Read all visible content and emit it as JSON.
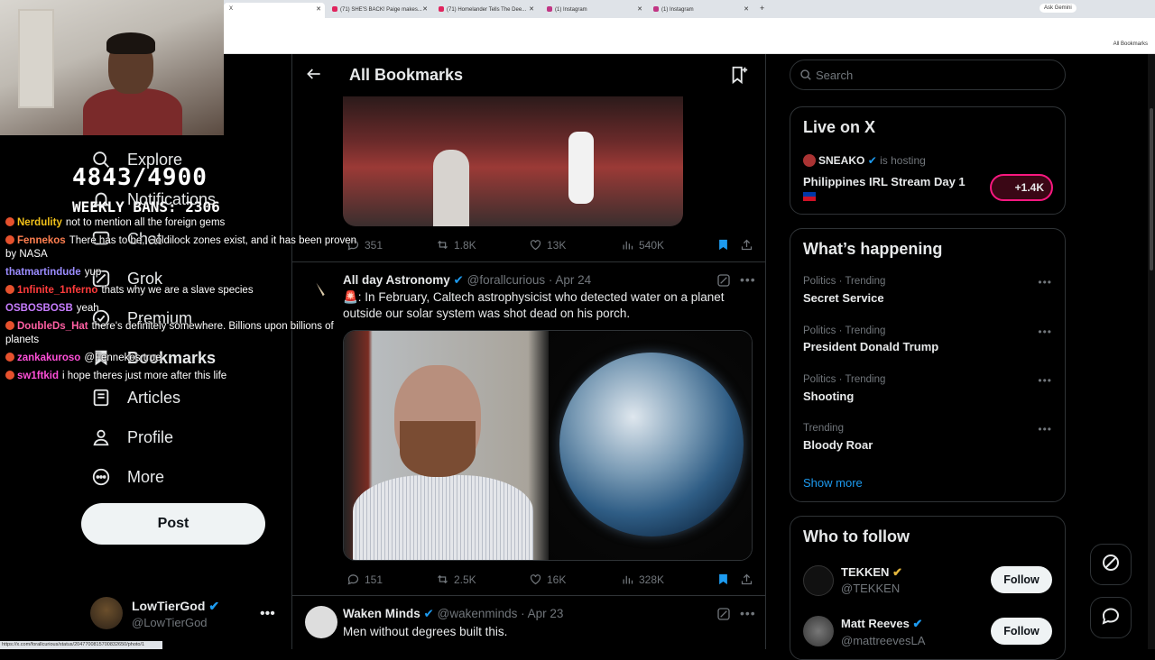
{
  "browser": {
    "tabs": [
      {
        "title": "X",
        "active": true
      },
      {
        "title": "(71) SHE'S BACK! Paige makes...",
        "active": false
      },
      {
        "title": "(71) Homelander Tells The Dee...",
        "active": false
      },
      {
        "title": "(1) Instagram",
        "active": false
      },
      {
        "title": "(1) Instagram",
        "active": false
      }
    ],
    "gemini_label": "Ask Gemini",
    "bookmarks_folder": "All Bookmarks",
    "status_url": "https://x.com/forallcurious/status/2047700815700832650/photo/1"
  },
  "stream": {
    "counter": "4843/4900",
    "weekly": "WEEKLY BANS: 2306",
    "chat": [
      {
        "user": "Nerdulity",
        "color": "#f2c21a",
        "text": "not to mention all the foreign gems"
      },
      {
        "user": "Fennekos",
        "color": "#ff7f50",
        "text": "There has to be, Goldilock zones exist, and it has been proven by NASA"
      },
      {
        "user": "thatmartindude",
        "color": "#9b8cff",
        "text": "yup"
      },
      {
        "user": "1nfinite_1nferno",
        "color": "#ff3b3b",
        "text": "thats why we are a slave species"
      },
      {
        "user": "OSBOSBOSB",
        "color": "#c77dff",
        "text": "yeah"
      },
      {
        "user": "DoubleDs_Hat",
        "color": "#ff5fa2",
        "text": "there's definitely somewhere. Billions upon billions of planets"
      },
      {
        "user": "zankakuroso",
        "color": "#ff4fd8",
        "text": "@Fennekos true"
      },
      {
        "user": "sw1ftkid",
        "color": "#ff4fd8",
        "text": "i hope theres just more after this life"
      }
    ]
  },
  "nav": {
    "items": [
      {
        "label": "Explore",
        "icon": "search-icon"
      },
      {
        "label": "Notifications",
        "icon": "bell-icon"
      },
      {
        "label": "Chat",
        "icon": "chat-icon"
      },
      {
        "label": "Grok",
        "icon": "grok-icon"
      },
      {
        "label": "Premium",
        "icon": "premium-icon"
      },
      {
        "label": "Bookmarks",
        "icon": "bookmark-icon"
      },
      {
        "label": "Articles",
        "icon": "articles-icon"
      },
      {
        "label": "Profile",
        "icon": "profile-icon"
      },
      {
        "label": "More",
        "icon": "more-icon"
      }
    ],
    "post_label": "Post",
    "account": {
      "name": "LowTierGod",
      "handle": "@LowTierGod"
    }
  },
  "main": {
    "title": "All Bookmarks",
    "tweets": [
      {
        "replies": "351",
        "reposts": "1.8K",
        "likes": "13K",
        "views": "540K"
      },
      {
        "name": "All day Astronomy",
        "handle": "@forallcurious",
        "date": "Apr 24",
        "text": "🚨: In February, Caltech astrophysicist who detected water on a planet outside our solar system was shot dead on his porch.",
        "replies": "151",
        "reposts": "2.5K",
        "likes": "16K",
        "views": "328K"
      },
      {
        "name": "Waken Minds",
        "handle": "@wakenminds",
        "date": "Apr 23",
        "text": "Men without degrees built this."
      }
    ]
  },
  "sidebar": {
    "search_placeholder": "Search",
    "live": {
      "title": "Live on X",
      "host": "SNEAKO",
      "hosting_text": "is hosting",
      "stream_title": "Philippines IRL Stream Day 1",
      "listeners": "+1.4K"
    },
    "happening": {
      "title": "What’s happening",
      "trends": [
        {
          "meta": "Politics · Trending",
          "name": "Secret Service"
        },
        {
          "meta": "Politics · Trending",
          "name": "President Donald Trump"
        },
        {
          "meta": "Politics · Trending",
          "name": "Shooting"
        },
        {
          "meta": "Trending",
          "name": "Bloody Roar"
        }
      ],
      "show_more": "Show more"
    },
    "who_to_follow": {
      "title": "Who to follow",
      "accounts": [
        {
          "name": "TEKKEN",
          "handle": "@TEKKEN",
          "button": "Follow"
        },
        {
          "name": "Matt Reeves",
          "handle": "@mattreevesLA",
          "button": "Follow"
        }
      ]
    }
  },
  "colors": {
    "accent": "#1d9bf0",
    "background": "#000000",
    "live_pill": "#f91880"
  }
}
